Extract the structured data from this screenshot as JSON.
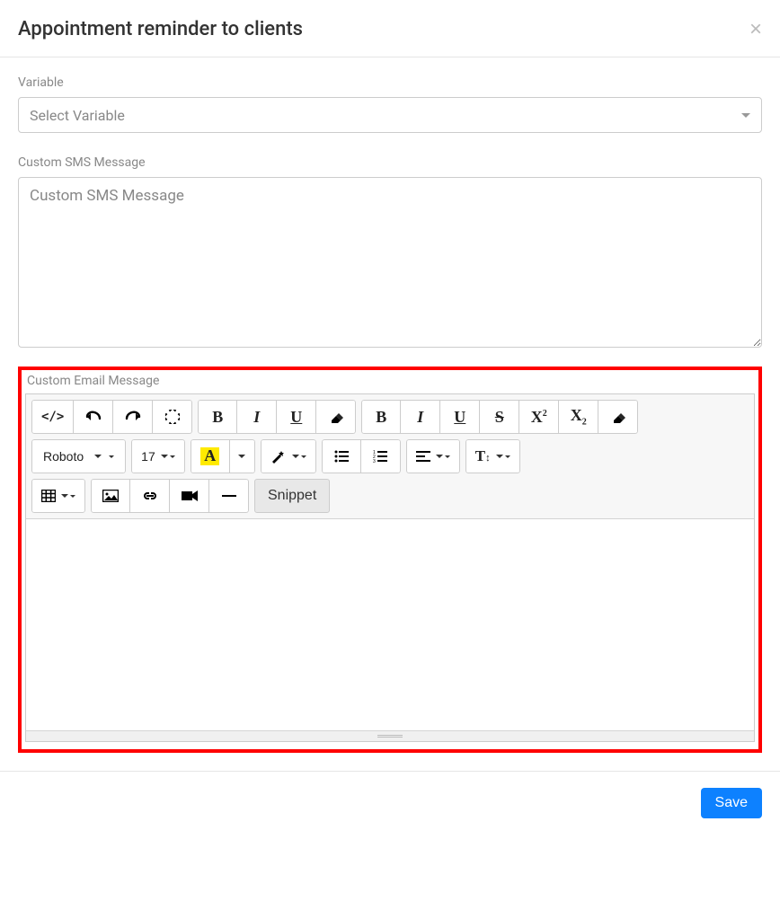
{
  "header": {
    "title": "Appointment reminder to clients"
  },
  "variable": {
    "label": "Variable",
    "placeholder": "Select Variable"
  },
  "sms": {
    "label": "Custom SMS Message",
    "placeholder": "Custom SMS Message",
    "value": ""
  },
  "email": {
    "label": "Custom Email Message",
    "font_name": "Roboto",
    "font_size": "17",
    "snippet_label": "Snippet"
  },
  "footer": {
    "save_label": "Save"
  }
}
